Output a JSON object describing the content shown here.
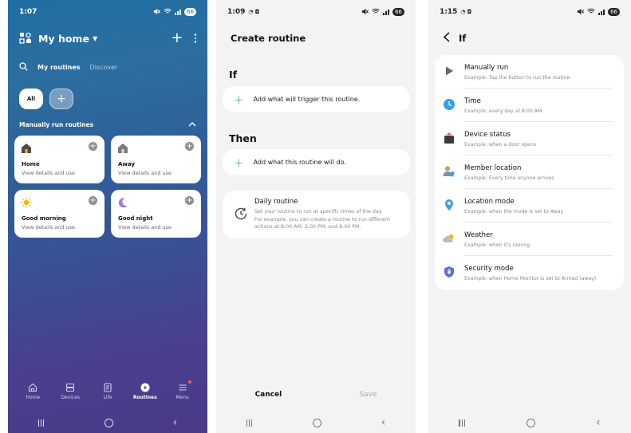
{
  "screen1": {
    "status": {
      "time": "1:07",
      "battery": "66"
    },
    "header": {
      "title": "My home"
    },
    "tabs": {
      "my_routines": "My routines",
      "discover": "Discover"
    },
    "chips": {
      "all": "All",
      "add": "+"
    },
    "section": {
      "title": "Manually run routines"
    },
    "cards": [
      {
        "title": "Home",
        "subtitle": "View details and use",
        "icon": "house-icon"
      },
      {
        "title": "Away",
        "subtitle": "View details and use",
        "icon": "house-away-icon"
      },
      {
        "title": "Good morning",
        "subtitle": "View details and use",
        "icon": "sun-icon"
      },
      {
        "title": "Good night",
        "subtitle": "View details and use",
        "icon": "moon-icon"
      }
    ],
    "nav": [
      {
        "label": "Home",
        "icon": "home-nav-icon"
      },
      {
        "label": "Devices",
        "icon": "devices-icon"
      },
      {
        "label": "Life",
        "icon": "life-icon"
      },
      {
        "label": "Routines",
        "icon": "routines-icon",
        "active": true
      },
      {
        "label": "Menu",
        "icon": "menu-icon"
      }
    ],
    "colors": {
      "accent_sun": "#f2b705",
      "accent_moon": "#9b7fe0",
      "card_icon": "#555555"
    }
  },
  "screen2": {
    "status": {
      "time": "1:09",
      "battery": "66"
    },
    "title": "Create routine",
    "if_label": "If",
    "if_add": "Add what will trigger this routine.",
    "then_label": "Then",
    "then_add": "Add what this routine will do.",
    "daily": {
      "title": "Daily routine",
      "desc_line1": "Set your routine to run at specific times of the day.",
      "desc_line2": "For example, you can create a routine to run different",
      "desc_line3": "actions at 8:00 AM, 2:00 PM, and 8:00 PM."
    },
    "footer": {
      "cancel": "Cancel",
      "save": "Save"
    },
    "colors": {
      "plus": "#2a9d5c"
    }
  },
  "screen3": {
    "status": {
      "time": "1:15",
      "battery": "66"
    },
    "title": "If",
    "conditions": [
      {
        "name": "Manually run",
        "example": "Example: Tap the button to run the routine.",
        "icon": "play-icon"
      },
      {
        "name": "Time",
        "example": "Example: every day at 8:00 AM",
        "icon": "clock-icon"
      },
      {
        "name": "Device status",
        "example": "Example: when a door opens",
        "icon": "device-icon"
      },
      {
        "name": "Member location",
        "example": "Example: Every time anyone arrives",
        "icon": "member-location-icon"
      },
      {
        "name": "Location mode",
        "example": "Example: when the mode is set to Away",
        "icon": "location-pin-icon"
      },
      {
        "name": "Weather",
        "example": "Example: when it's raining",
        "icon": "weather-icon"
      },
      {
        "name": "Security mode",
        "example": "Example: when Home Monitor is set to Armed (away)",
        "icon": "shield-icon"
      }
    ]
  }
}
